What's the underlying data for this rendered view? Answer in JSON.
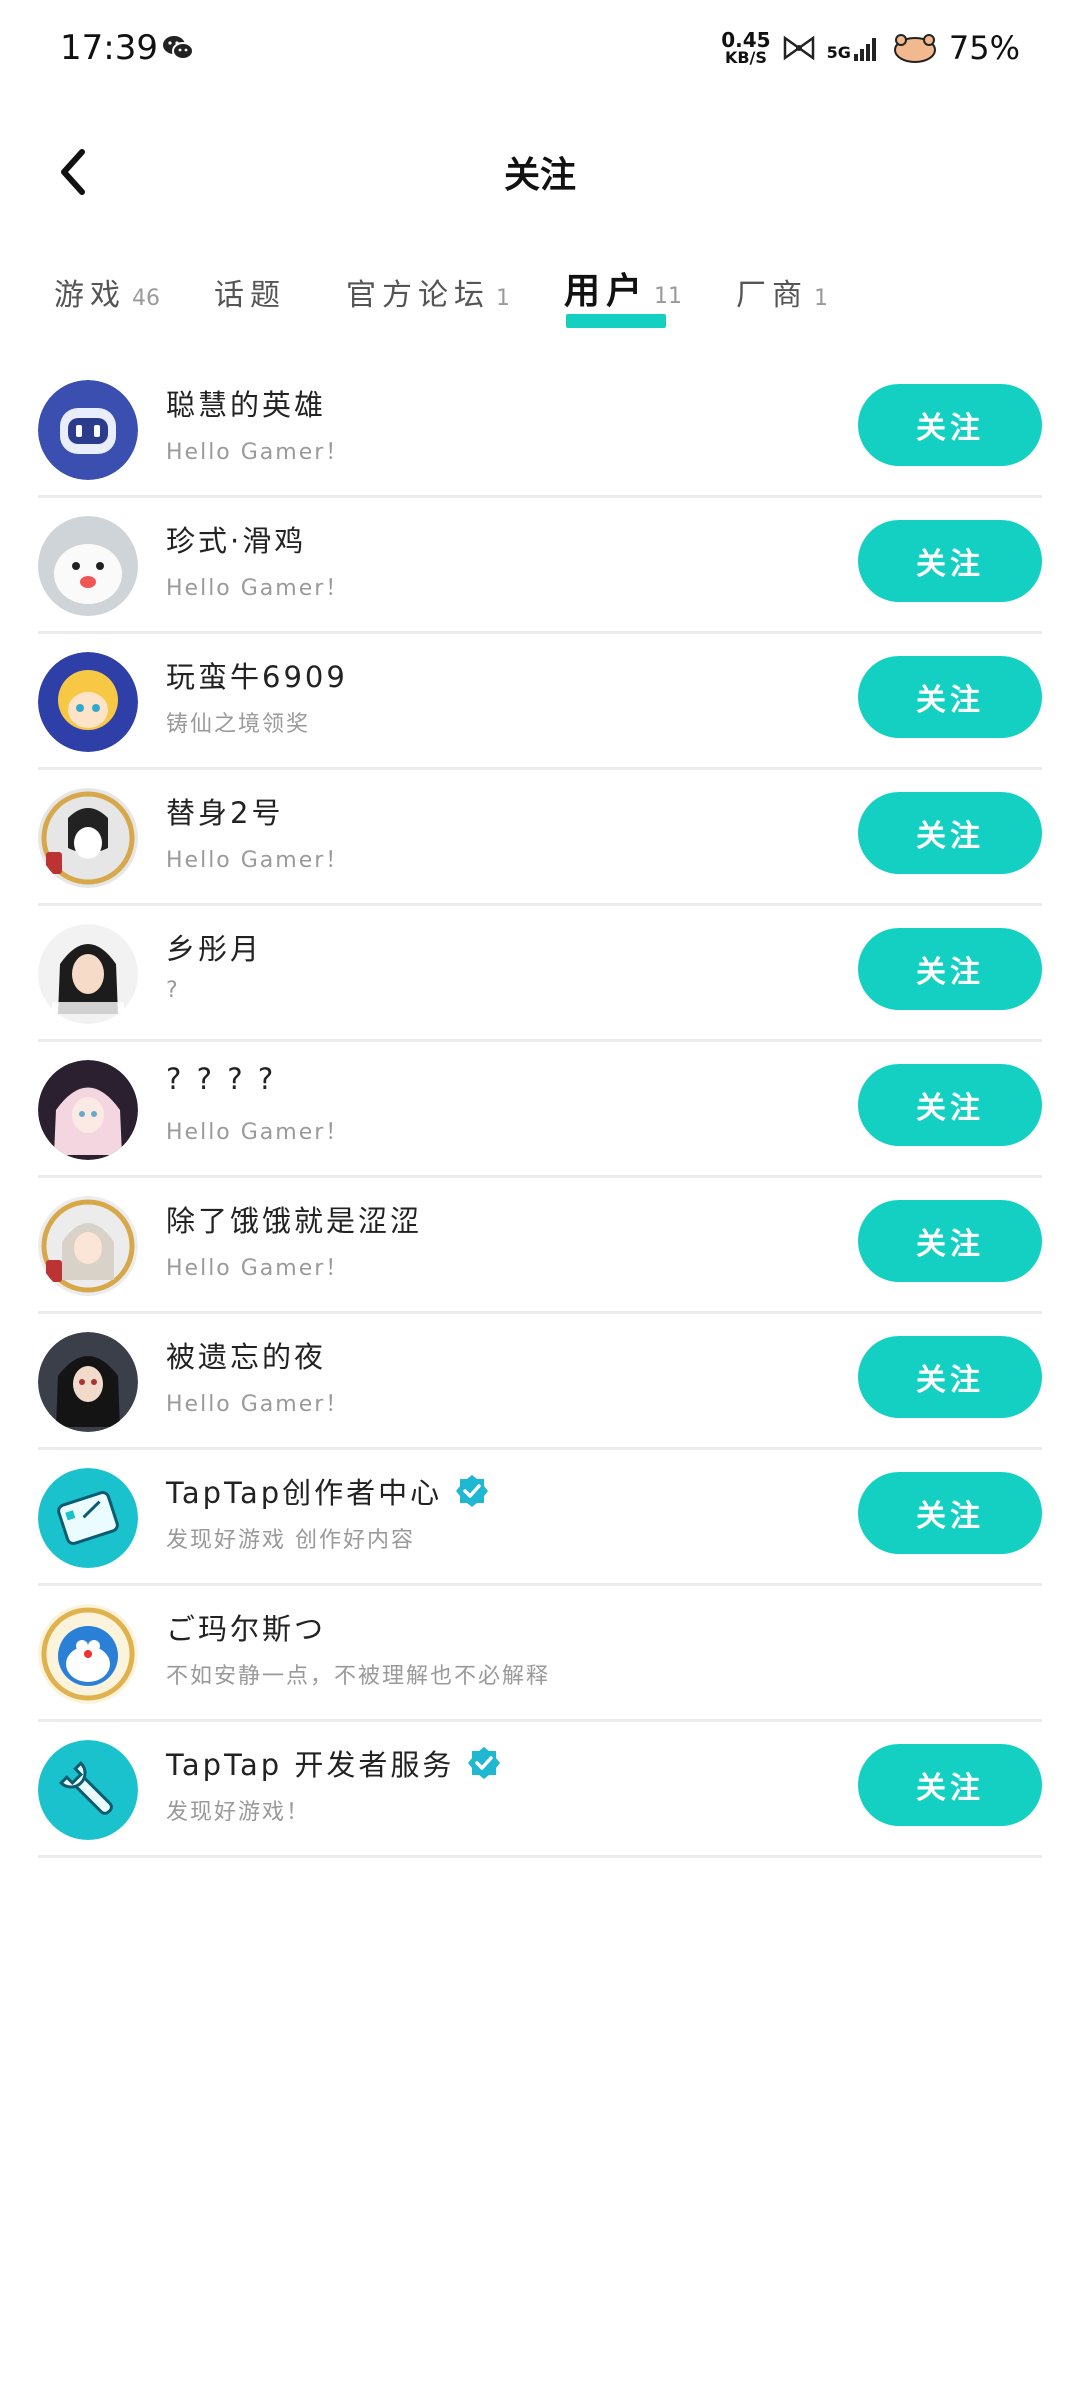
{
  "status_bar": {
    "time": "17:39",
    "net_speed_value": "0.45",
    "net_speed_unit": "KB/S",
    "network": "5G",
    "battery": "75%"
  },
  "header": {
    "title": "关注"
  },
  "tabs": [
    {
      "label": "游戏",
      "count": "46",
      "active": false
    },
    {
      "label": "话题",
      "count": "",
      "active": false
    },
    {
      "label": "官方论坛",
      "count": "1",
      "active": false
    },
    {
      "label": "用户",
      "count": "11",
      "active": true
    },
    {
      "label": "厂商",
      "count": "1",
      "active": false
    }
  ],
  "follow_label": "关注",
  "accent_color": "#14d0c3",
  "users": [
    {
      "name": "聪慧的英雄",
      "bio": "Hello Gamer！",
      "verified": false,
      "show_follow": true,
      "follow": "关注"
    },
    {
      "name": "珍式·滑鸡",
      "bio": "Hello Gamer！",
      "verified": false,
      "show_follow": true,
      "follow": "关注"
    },
    {
      "name": "玩蛮牛6909",
      "bio": "铸仙之境领奖",
      "verified": false,
      "show_follow": true,
      "follow": "关注"
    },
    {
      "name": "替身2号",
      "bio": "Hello Gamer！",
      "verified": false,
      "show_follow": true,
      "follow": "关注"
    },
    {
      "name": "乡彤月",
      "bio": "?",
      "verified": false,
      "show_follow": true,
      "follow": "关注"
    },
    {
      "name": "? ? ? ?",
      "bio": "Hello Gamer！",
      "verified": false,
      "show_follow": true,
      "follow": "关注"
    },
    {
      "name": "除了饿饿就是涩涩",
      "bio": "Hello Gamer！",
      "verified": false,
      "show_follow": true,
      "follow": "关注"
    },
    {
      "name": "被遗忘的夜",
      "bio": "Hello Gamer！",
      "verified": false,
      "show_follow": true,
      "follow": "关注"
    },
    {
      "name": "TapTap创作者中心",
      "bio": "发现好游戏 创作好内容",
      "verified": true,
      "show_follow": true,
      "follow": "关注"
    },
    {
      "name": "ご玛尔斯つ",
      "bio": "不如安静一点，不被理解也不必解释",
      "verified": false,
      "show_follow": false
    },
    {
      "name": "TapTap 开发者服务",
      "bio": "发现好游戏！",
      "verified": true,
      "show_follow": true,
      "follow": "关注"
    }
  ]
}
